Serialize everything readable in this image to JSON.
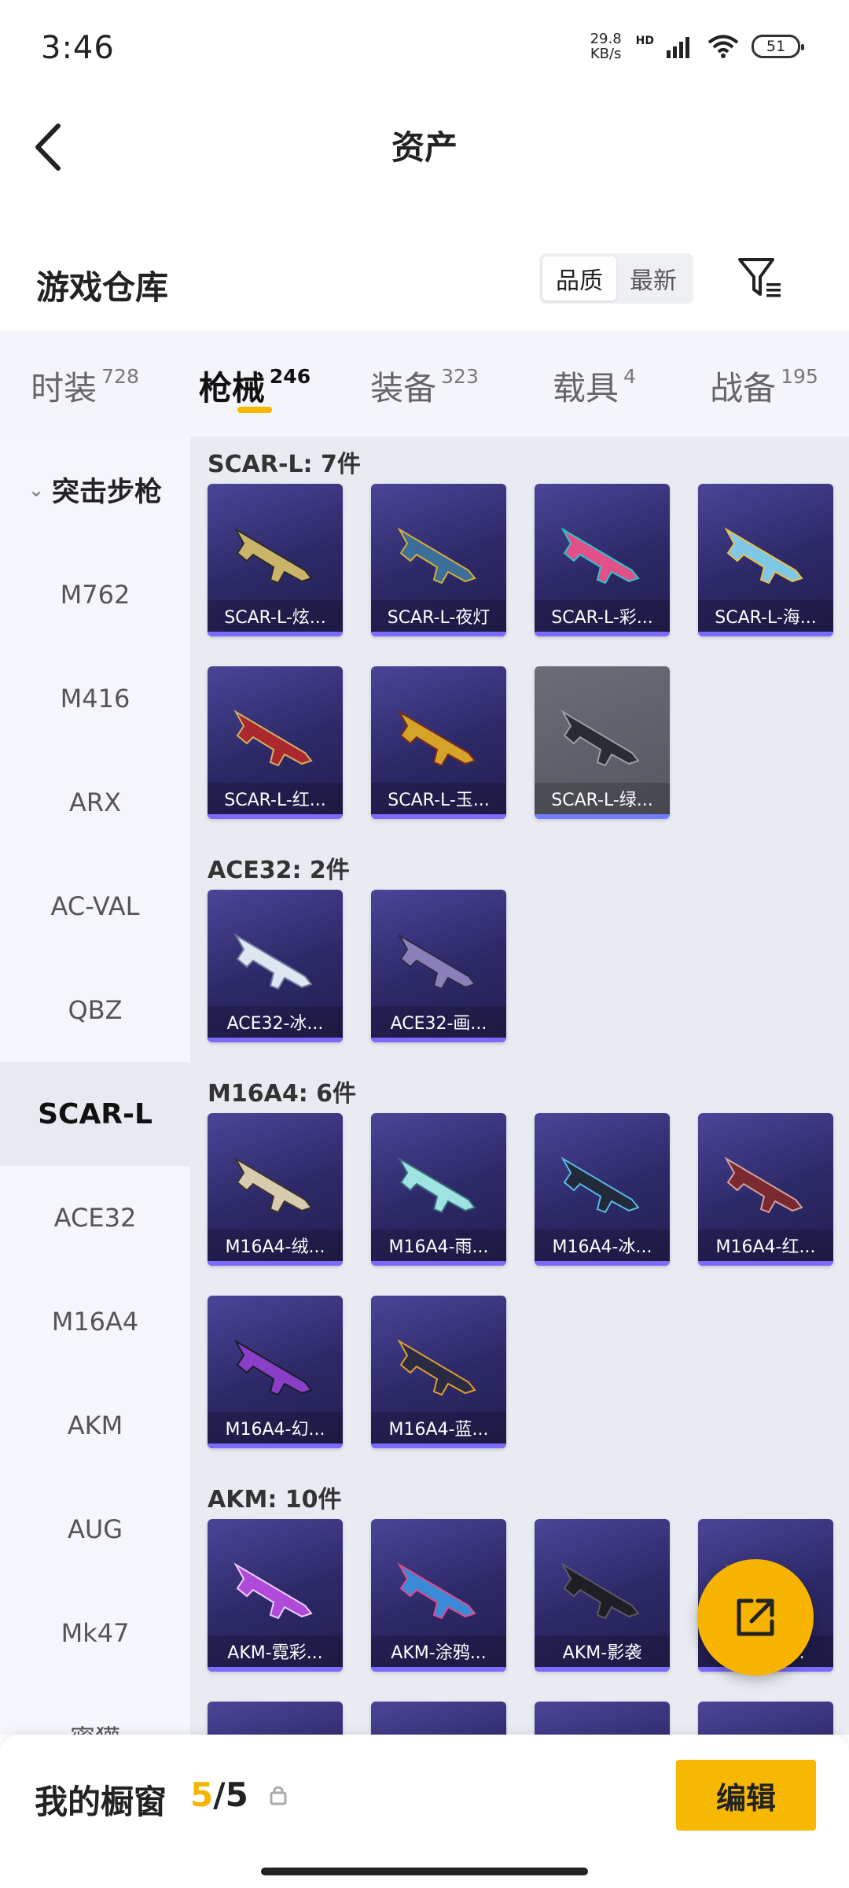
{
  "status": {
    "time": "3:46",
    "net_speed": "29.8",
    "net_unit": "KB/s",
    "hd": "HD",
    "battery": "51"
  },
  "header": {
    "title": "资产"
  },
  "repo": {
    "title": "游戏仓库",
    "sort_options": [
      "品质",
      "最新"
    ]
  },
  "tabs": [
    {
      "label": "时装",
      "count": "728"
    },
    {
      "label": "枪械",
      "count": "246"
    },
    {
      "label": "装备",
      "count": "323"
    },
    {
      "label": "载具",
      "count": "4"
    },
    {
      "label": "战备",
      "count": "195"
    }
  ],
  "sidebar": {
    "category": "突击步枪",
    "items": [
      "M762",
      "M416",
      "ARX",
      "AC-VAL",
      "QBZ",
      "SCAR-L",
      "ACE32",
      "M16A4",
      "AKM",
      "AUG",
      "Mk47",
      "蜜獾"
    ]
  },
  "groups": [
    {
      "title": "SCAR-L: 7件",
      "items": [
        "SCAR-L-炫...",
        "SCAR-L-夜灯",
        "SCAR-L-彩...",
        "SCAR-L-海...",
        "SCAR-L-红...",
        "SCAR-L-玉...",
        "SCAR-L-绿..."
      ]
    },
    {
      "title": "ACE32: 2件",
      "items": [
        "ACE32-冰...",
        "ACE32-画..."
      ]
    },
    {
      "title": "M16A4: 6件",
      "items": [
        "M16A4-绒...",
        "M16A4-雨...",
        "M16A4-冰...",
        "M16A4-红...",
        "M16A4-幻...",
        "M16A4-蓝..."
      ]
    },
    {
      "title": "AKM: 10件",
      "items": [
        "AKM-霓彩...",
        "AKM-涂鸦...",
        "AKM-影袭",
        "AKM-曲..."
      ]
    }
  ],
  "showcase": {
    "title": "我的橱窗",
    "current": "5",
    "total": "/5",
    "edit_label": "编辑"
  },
  "colors": {
    "accent": "#f6b800",
    "card_bg": "#2c2866",
    "sidebar_bg": "#f4f6fb"
  }
}
